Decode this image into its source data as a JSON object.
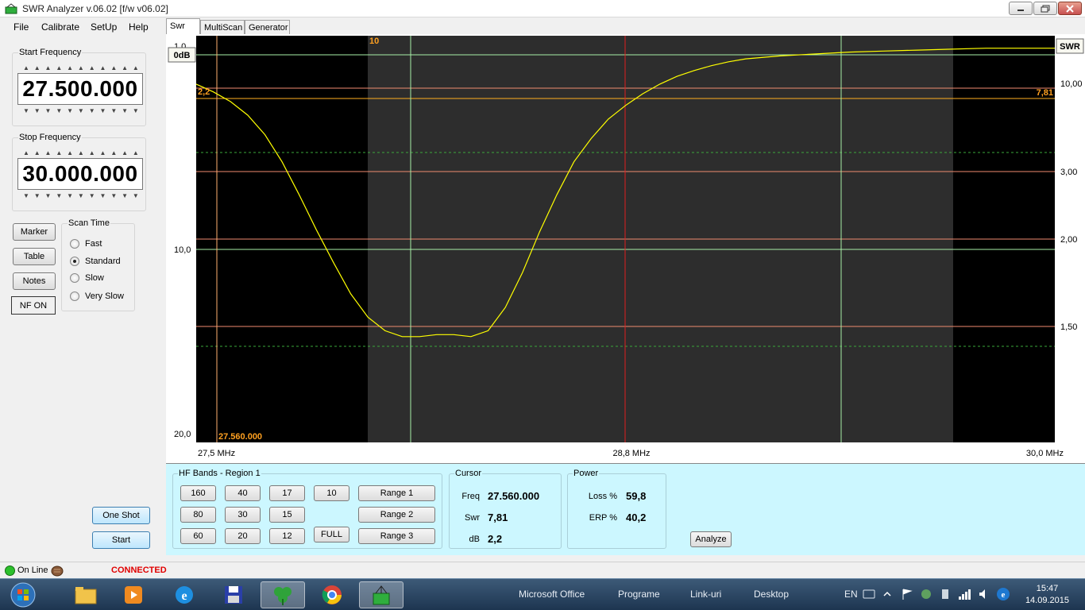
{
  "window": {
    "title": "SWR Analyzer v.06.02 [f/w v06.02]"
  },
  "menu": [
    "File",
    "Calibrate",
    "SetUp",
    "Help"
  ],
  "start_frequency": {
    "label": "Start Frequency",
    "value": "27.500.000"
  },
  "stop_frequency": {
    "label": "Stop Frequency",
    "value": "30.000.000"
  },
  "side_buttons": {
    "marker": "Marker",
    "table": "Table",
    "notes": "Notes",
    "nf_on": "NF ON"
  },
  "scan_time": {
    "label": "Scan Time",
    "options": [
      "Fast",
      "Standard",
      "Slow",
      "Very Slow"
    ],
    "selected": "Standard"
  },
  "actions": {
    "one_shot": "One Shot",
    "start": "Start"
  },
  "tabs": [
    "Swr",
    "MultiScan",
    "Generator"
  ],
  "chart_data": {
    "type": "line",
    "left_axis_label": "0dB",
    "right_axis_label": "SWR",
    "left_ticks": [
      "1,0",
      "10,0",
      "20,0"
    ],
    "right_ticks": [
      "10,00",
      "3,00",
      "2,00",
      "1,50"
    ],
    "x_ticks": [
      "27,5 MHz",
      "28,8 MHz",
      "30,0 MHz"
    ],
    "xlim": [
      27.5,
      30.0
    ],
    "marker_top_label": "10",
    "cursor_freq_label": "27.560.000",
    "cursor_db_label": "2,2",
    "cursor_swr_label": "7,81",
    "line_color": "#ffff00",
    "series": [
      {
        "x": [
          27.5,
          27.55,
          27.6,
          27.65,
          27.7,
          27.75,
          27.8,
          27.85,
          27.9,
          27.95,
          28.0,
          28.05,
          28.1,
          28.15,
          28.2,
          28.25,
          28.3,
          28.35,
          28.4,
          28.45,
          28.5,
          28.55,
          28.6,
          28.65,
          28.7,
          28.75,
          28.8,
          28.85,
          28.9,
          28.95,
          29.0,
          29.05,
          29.1,
          29.2,
          29.3,
          29.4,
          29.5,
          29.6,
          29.7,
          29.8,
          29.9,
          30.0
        ],
        "db": [
          2.0,
          2.4,
          2.9,
          3.6,
          4.6,
          6.0,
          7.7,
          9.5,
          11.2,
          12.8,
          14.0,
          14.7,
          15.0,
          15.0,
          14.9,
          14.9,
          15.0,
          14.7,
          13.5,
          11.7,
          9.6,
          7.7,
          6.0,
          4.8,
          3.8,
          3.1,
          2.5,
          2.0,
          1.6,
          1.3,
          1.05,
          0.85,
          0.7,
          0.55,
          0.45,
          0.35,
          0.3,
          0.25,
          0.2,
          0.15,
          0.15,
          0.15
        ]
      }
    ]
  },
  "hf_bands": {
    "label": "HF Bands - Region 1",
    "bands": [
      "160",
      "40",
      "17",
      "10",
      "80",
      "30",
      "15",
      "60",
      "20",
      "12",
      "FULL"
    ],
    "ranges": [
      "Range 1",
      "Range 2",
      "Range 3"
    ]
  },
  "cursor": {
    "label": "Cursor",
    "freq_label": "Freq",
    "freq": "27.560.000",
    "swr_label": "Swr",
    "swr": "7,81",
    "db_label": "dB",
    "db": "2,2"
  },
  "power": {
    "label": "Power",
    "loss_label": "Loss %",
    "loss": "59,8",
    "erp_label": "ERP %",
    "erp": "40,2"
  },
  "analyze_button": "Analyze",
  "status": {
    "online": "On Line",
    "connection": "CONNECTED",
    "connection_color": "#e00000"
  },
  "taskbar": {
    "items": [
      "Microsoft Office",
      "Programe",
      "Link-uri",
      "Desktop"
    ],
    "language": "EN",
    "time": "15:47",
    "date": "14.09.2015"
  }
}
